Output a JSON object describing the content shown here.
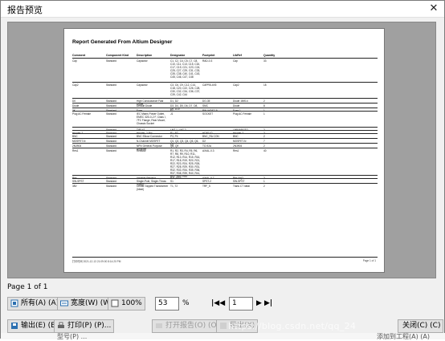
{
  "window": {
    "title": "报告预览",
    "close_glyph": "✕"
  },
  "report": {
    "title": "Report Generated From Altium Designer",
    "columns": [
      "Comment",
      "Component Kind",
      "Description",
      "Designator",
      "Footprint",
      "LibRef",
      "Quantity"
    ],
    "rows": [
      [
        "Cap",
        "Standard",
        "Capacitor",
        "C1, C2, C4, C5, C7, C8, C10, C11, C13, C15, C16, C17, C19, C21, C23, C24, C25, C27, C29, C31, C33, C35, C38, C40, C41, C43, C45, C46, C47, C48",
        "RAD-0.3",
        "Cap",
        "33"
      ],
      [
        "Cap2",
        "Standard",
        "Capacitor",
        "C3, C6, C9, C12, C14, C18, C20, C22, C26, C28, C30, C32, C34, C36, C37, C39, C42, C44",
        "CAPR5-4X5",
        "Cap2",
        "18"
      ],
      [
        "D0",
        "Standard",
        "High Conductance Fast Diode",
        "D1, D2",
        "DO-35",
        "Diode 1N914",
        "2"
      ],
      [
        "Diode",
        "Standard",
        "Default Diode",
        "D3, D4, D5, D6, D7, D8, D9, D10",
        "SMC",
        "Diode",
        "8"
      ],
      [
        "3K",
        "Standard",
        "Fuse",
        "F1",
        "PIN-W2/E2.8",
        "Fuse 1",
        "1"
      ],
      [
        "Plug AC Female",
        "Standard",
        "IEC Mains Power Outlet, EMEC 32D-0-2 F, Class I, 7FC Flange, Rear Mount, Chassis Socket",
        "J1",
        "SOCKET",
        "Plug AC Female",
        "1"
      ],
      [
        "",
        "Standard",
        "TIP142",
        "LM7.1, LM7.2",
        "",
        "LM5465S/TO",
        "2"
      ],
      [
        "Header 2",
        "Standard",
        "Header, 2-Pin",
        "P1, P2",
        "HDR1X2",
        "Header 2",
        "2"
      ],
      [
        "BNC",
        "Standard",
        "BNC Elbow Connector",
        "P3, P4",
        "BNC_RA CON",
        "BNC",
        "2"
      ],
      [
        "MOSFET-N",
        "Standard",
        "N-Channel MOSFET",
        "Q1, Q2, Q3, Q4, Q5, Q6, Q7",
        "D2",
        "MOSFET-N",
        "7"
      ],
      [
        "2N3904",
        "Standard",
        "NPN General Purpose Amplifier",
        "Q8, Q9",
        "TO-92A",
        "2N3904",
        "2"
      ],
      [
        "Res1",
        "Standard",
        "Resistor",
        "R1, R2, R3, R4, R5, R6, R7, R8, R9, R10, R11, R12, R13, R14, R15, R16, R17, R18, R19, R20, R21, R22, R23, R24, R25, R26, R27, R28, R29, R30, R31, R32, R33, R34, R35, R36, R37, R38, R39, R40, R41, R42, R43, R44",
        "AXIAL-0.3",
        "Res1",
        "40"
      ],
      [
        "Res",
        "Standard",
        "Variable Resistor",
        "R11, R22",
        "AXIAL-0.7",
        "Res Adj2",
        "2"
      ],
      [
        "SW-SPST",
        "Standard",
        "Single-Pole, Single-Throw Switch",
        "S1",
        "SPST-2",
        "SW-SPST",
        "1"
      ],
      [
        "38V",
        "Standard",
        "Center-Tapped Transformer (Ideal)",
        "T1, T2",
        "TRF_5",
        "Trans CT Ideal",
        "2"
      ]
    ],
    "footer_left": "打印时间 2021-12-13 21:09:00  8:14:20 PM",
    "footer_right": "Page 1 of 1"
  },
  "status": {
    "page": "Page 1 of 1"
  },
  "toolbar": {
    "all_label": "所有(A) (A)",
    "width_label": "宽度(W) (W)",
    "zoom100_label": "100%",
    "zoom_value": "53",
    "percent": "%",
    "first_glyph": "|◀◀",
    "page_value": "1",
    "next_glyph": "▶",
    "last_glyph": "▶|",
    "export_label": "输出(E) (E)...",
    "print_label": "打印(P) (P)...",
    "open_report_label": "打开报告(O) (O)",
    "export_excel_label": "导出(X)",
    "close_label": "关闭(C) (C)"
  },
  "watermark": "https://blog.csdn.net/qq_24",
  "background": {
    "left_text": "型号(P)  ...",
    "right_text": "添加到工程(A) (A)"
  }
}
